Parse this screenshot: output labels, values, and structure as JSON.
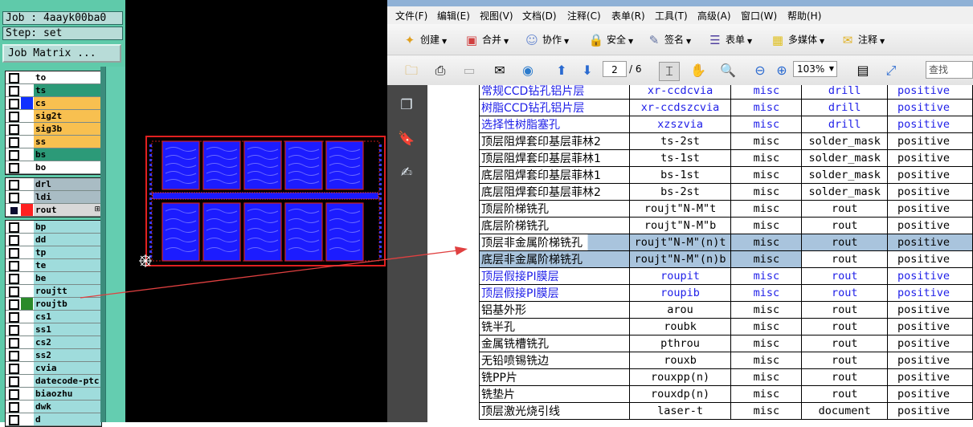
{
  "cam": {
    "job_text": "Job : 4aayk00ba0",
    "step_text": "Step: set",
    "job_matrix_label": "Job Matrix ...",
    "group1": [
      {
        "name": "to",
        "color": "#ffffff",
        "swatch": ""
      },
      {
        "name": "ts",
        "color": "#2c9a78",
        "swatch": ""
      },
      {
        "name": "cs",
        "color": "#f8c050",
        "swatch": "#1030ff"
      },
      {
        "name": "sig2t",
        "color": "#f8c050",
        "swatch": ""
      },
      {
        "name": "sig3b",
        "color": "#f8c050",
        "swatch": ""
      },
      {
        "name": "ss",
        "color": "#f8c050",
        "swatch": ""
      },
      {
        "name": "bs",
        "color": "#2c9a78",
        "swatch": ""
      },
      {
        "name": "bo",
        "color": "#ffffff",
        "swatch": ""
      }
    ],
    "group2": [
      {
        "name": "drl",
        "color": "#a9bcc4",
        "swatch": ""
      },
      {
        "name": "ldi",
        "color": "#a9bcc4",
        "swatch": ""
      },
      {
        "name": "rout",
        "color": "#d8d8d8",
        "swatch": "#ff2020",
        "dark_cb": true,
        "marker": "⊞"
      }
    ],
    "group3": [
      {
        "name": "bp",
        "color": "#9fdcdc",
        "swatch": ""
      },
      {
        "name": "dd",
        "color": "#9fdcdc",
        "swatch": ""
      },
      {
        "name": "tp",
        "color": "#9fdcdc",
        "swatch": ""
      },
      {
        "name": "te",
        "color": "#9fdcdc",
        "swatch": ""
      },
      {
        "name": "be",
        "color": "#9fdcdc",
        "swatch": ""
      },
      {
        "name": "roujtt",
        "color": "#9fdcdc",
        "swatch": ""
      },
      {
        "name": "roujtb",
        "color": "#9fdcdc",
        "swatch": "#2a8a2a"
      },
      {
        "name": "cs1",
        "color": "#9fdcdc",
        "swatch": ""
      },
      {
        "name": "ss1",
        "color": "#9fdcdc",
        "swatch": ""
      },
      {
        "name": "cs2",
        "color": "#9fdcdc",
        "swatch": ""
      },
      {
        "name": "ss2",
        "color": "#9fdcdc",
        "swatch": ""
      },
      {
        "name": "cvia",
        "color": "#9fdcdc",
        "swatch": ""
      },
      {
        "name": "datecode-ptc",
        "color": "#9fdcdc",
        "swatch": ""
      },
      {
        "name": "biaozhu",
        "color": "#9fdcdc",
        "swatch": ""
      },
      {
        "name": "dwk",
        "color": "#9fdcdc",
        "swatch": ""
      },
      {
        "name": "d",
        "color": "#9fdcdc",
        "swatch": ""
      }
    ]
  },
  "viewer": {
    "menu": [
      "文件(F)",
      "编辑(E)",
      "视图(V)",
      "文档(D)",
      "注释(C)",
      "表单(R)",
      "工具(T)",
      "高级(A)",
      "窗口(W)",
      "帮助(H)"
    ],
    "toolbar1": [
      {
        "label": "创建",
        "icon": "create-icon",
        "glyph": "✦"
      },
      {
        "label": "合并",
        "icon": "combine-icon",
        "glyph": "▣"
      },
      {
        "label": "协作",
        "icon": "collaborate-icon",
        "glyph": "☺"
      },
      {
        "label": "安全",
        "icon": "lock-icon",
        "glyph": "🔒"
      },
      {
        "label": "签名",
        "icon": "pen-icon",
        "glyph": "✎"
      },
      {
        "label": "表单",
        "icon": "form-icon",
        "glyph": "☰"
      },
      {
        "label": "多媒体",
        "icon": "multimedia-icon",
        "glyph": "▦"
      },
      {
        "label": "注释",
        "icon": "comment-icon",
        "glyph": "✉"
      }
    ],
    "page_current": "2",
    "page_total": "/ 6",
    "zoom": "103%",
    "search_placeholder": "查找",
    "rows": [
      {
        "c1": "常规CCD钻孔铝片层",
        "c2": "xr-ccdcvia",
        "c3": "misc",
        "c4": "drill",
        "c5": "positive",
        "blue": true
      },
      {
        "c1": "树脂CCD钻孔铝片层",
        "c2": "xr-ccdszcvia",
        "c3": "misc",
        "c4": "drill",
        "c5": "positive",
        "blue": true
      },
      {
        "c1": "选择性树脂塞孔",
        "c2": "xzszvia",
        "c3": "misc",
        "c4": "drill",
        "c5": "positive",
        "blue": true
      },
      {
        "c1": "顶层阻焊套印基层菲林2",
        "c2": "ts-2st",
        "c3": "misc",
        "c4": "solder_mask",
        "c5": "positive"
      },
      {
        "c1": "顶层阻焊套印基层菲林1",
        "c2": "ts-1st",
        "c3": "misc",
        "c4": "solder_mask",
        "c5": "positive"
      },
      {
        "c1": "底层阻焊套印基层菲林1",
        "c2": "bs-1st",
        "c3": "misc",
        "c4": "solder_mask",
        "c5": "positive"
      },
      {
        "c1": "底层阻焊套印基层菲林2",
        "c2": "bs-2st",
        "c3": "misc",
        "c4": "solder_mask",
        "c5": "positive"
      },
      {
        "c1": "顶层阶梯铣孔",
        "c2": "roujt\"N-M\"t",
        "c3": "misc",
        "c4": "rout",
        "c5": "positive"
      },
      {
        "c1": "底层阶梯铣孔",
        "c2": "roujt\"N-M\"b",
        "c3": "misc",
        "c4": "rout",
        "c5": "positive"
      },
      {
        "c1": "顶层非金属阶梯铣孔",
        "c2": "roujt\"N-M\"(n)t",
        "c3": "misc",
        "c4": "rout",
        "c5": "positive",
        "hl": "row"
      },
      {
        "c1": "底层非金属阶梯铣孔",
        "c2": "roujt\"N-M\"(n)b",
        "c3": "misc",
        "c4": "rout",
        "c5": "positive",
        "hl": "partial"
      },
      {
        "c1": "顶层假接PI膜层",
        "c2": "roupit",
        "c3": "misc",
        "c4": "rout",
        "c5": "positive",
        "blue": true
      },
      {
        "c1": "顶层假接PI膜层",
        "c2": "roupib",
        "c3": "misc",
        "c4": "rout",
        "c5": "positive",
        "blue": true
      },
      {
        "c1": "铝基外形",
        "c2": "arou",
        "c3": "misc",
        "c4": "rout",
        "c5": "positive"
      },
      {
        "c1": "铣半孔",
        "c2": "roubk",
        "c3": "misc",
        "c4": "rout",
        "c5": "positive"
      },
      {
        "c1": "金属铣槽铣孔",
        "c2": "pthrou",
        "c3": "misc",
        "c4": "rout",
        "c5": "positive"
      },
      {
        "c1": "无铅喷锡铣边",
        "c2": "rouxb",
        "c3": "misc",
        "c4": "rout",
        "c5": "positive"
      },
      {
        "c1": "铣PP片",
        "c2": "rouxpp(n)",
        "c3": "misc",
        "c4": "rout",
        "c5": "positive"
      },
      {
        "c1": "铣垫片",
        "c2": "rouxdp(n)",
        "c3": "misc",
        "c4": "rout",
        "c5": "positive"
      },
      {
        "c1": "顶层激光烧引线",
        "c2": "laser-t",
        "c3": "misc",
        "c4": "document",
        "c5": "positive"
      }
    ]
  }
}
